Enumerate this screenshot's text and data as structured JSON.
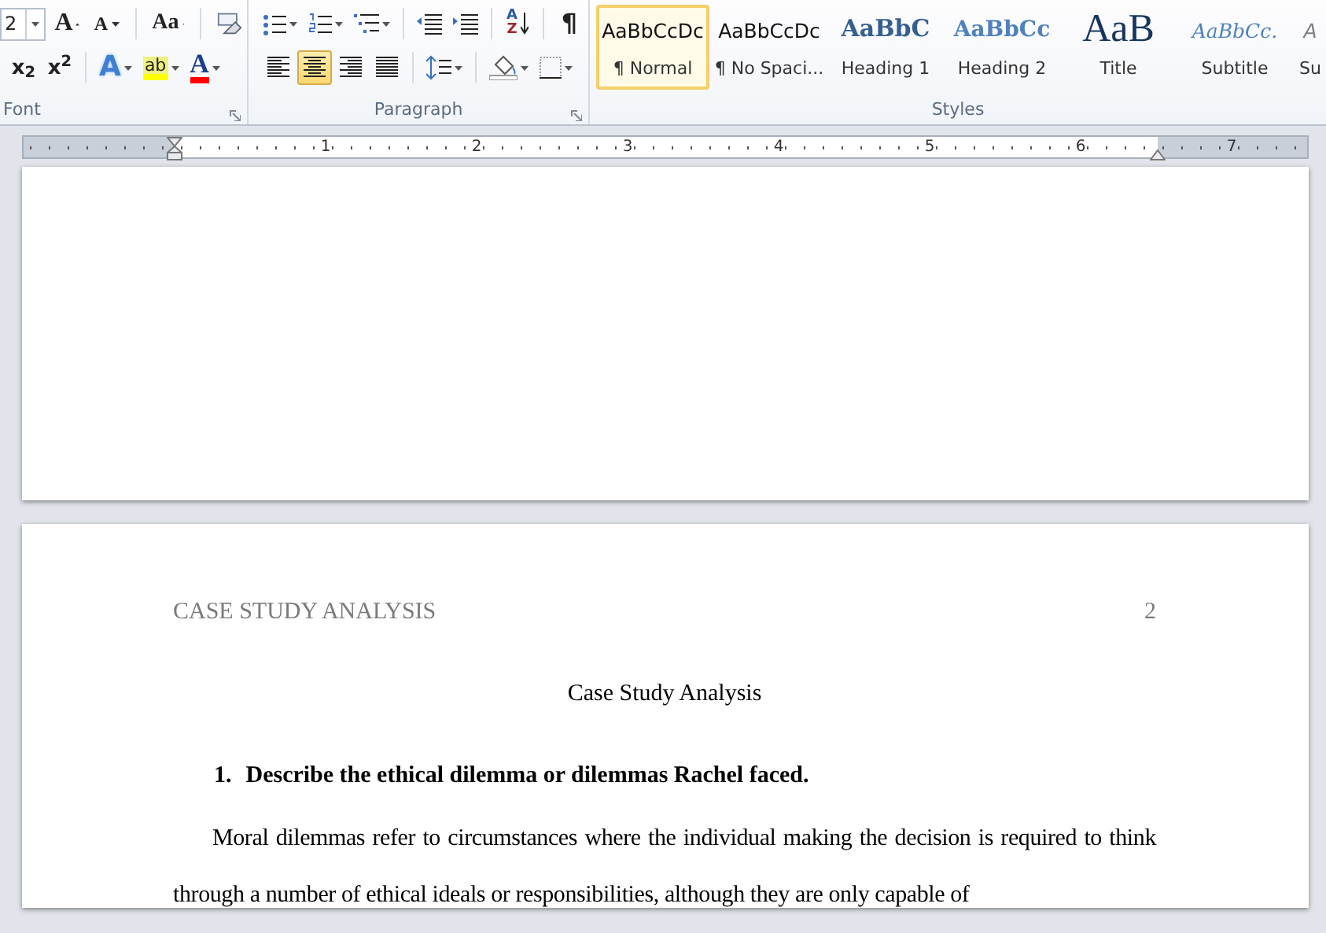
{
  "ribbon": {
    "font_group": {
      "label": "Font",
      "font_size": "2",
      "grow_font": "A",
      "shrink_font": "A",
      "change_case": "Aa",
      "subscript": "x$_{2}$",
      "superscript": "x$^{2}$",
      "text_effects": "A",
      "highlight": "ab",
      "font_color": "A"
    },
    "paragraph_group": {
      "label": "Paragraph",
      "sort": [
        "A",
        "Z"
      ],
      "show_marks": "¶",
      "alignment": [
        {
          "selected": false
        },
        {
          "selected": true
        },
        {
          "selected": false
        },
        {
          "selected": false
        }
      ]
    },
    "styles_group": {
      "label": "Styles",
      "items": [
        {
          "kind": "normal",
          "preview": "AaBbCcDc",
          "label": "¶ Normal",
          "selected": true
        },
        {
          "kind": "normal",
          "preview": "AaBbCcDc",
          "label": "¶ No Spaci...",
          "selected": false
        },
        {
          "kind": "heading1",
          "preview": "AaBbC",
          "label": "Heading 1",
          "selected": false
        },
        {
          "kind": "heading2",
          "preview": "AaBbCc",
          "label": "Heading 2",
          "selected": false
        },
        {
          "kind": "title",
          "preview": "AaB",
          "label": "Title",
          "selected": false
        },
        {
          "kind": "subtitle",
          "preview": "AaBbCc.",
          "label": "Subtitle",
          "selected": false
        },
        {
          "kind": "subtle",
          "preview": "A",
          "label": "Su",
          "selected": false
        }
      ]
    }
  },
  "ruler": {
    "numbers": [
      "1",
      "2",
      "3",
      "4",
      "5",
      "6",
      "7"
    ]
  },
  "document": {
    "header": {
      "running_head": "CASE STUDY ANALYSIS",
      "page_number": "2"
    },
    "title": "Case Study Analysis",
    "heading": {
      "number": "1.",
      "text": "Describe the ethical dilemma or dilemmas Rachel faced."
    },
    "paragraph": "Moral dilemmas refer to circumstances where the individual making the decision is required to think through a number of ethical ideals or responsibilities, although they are only capable of"
  }
}
